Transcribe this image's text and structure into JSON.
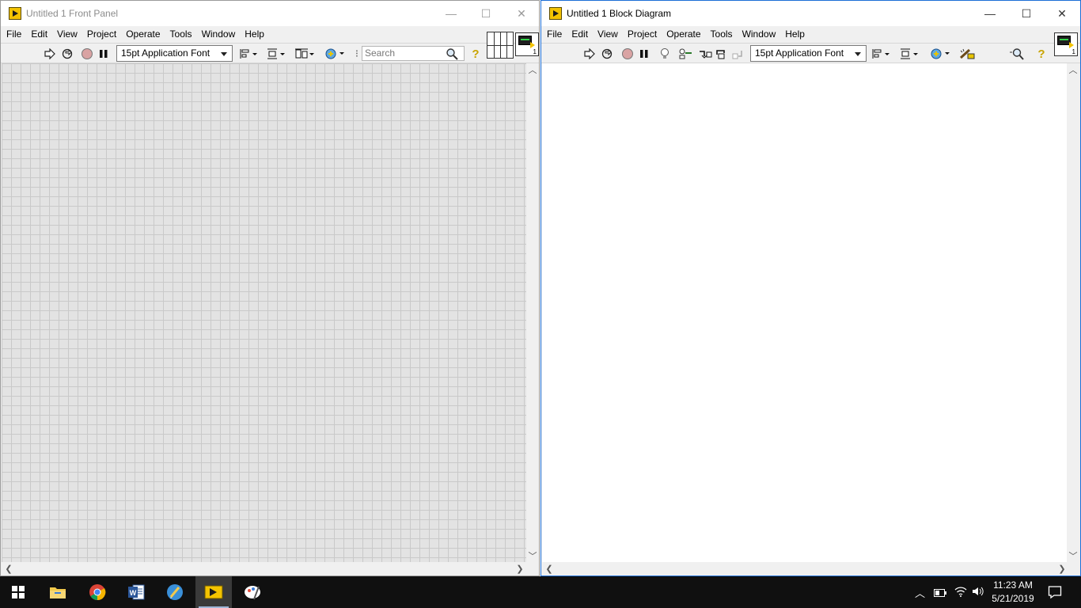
{
  "front_panel": {
    "title": "Untitled 1 Front Panel",
    "caption_buttons": {
      "minimize": "—",
      "maximize": "☐",
      "close": "✕"
    },
    "menu": [
      "File",
      "Edit",
      "View",
      "Project",
      "Operate",
      "Tools",
      "Window",
      "Help"
    ],
    "toolbar": {
      "font": "15pt Application Font",
      "search_placeholder": "Search",
      "help_glyph": "?"
    },
    "vi_icon_number": "1",
    "grid_visible": true
  },
  "block_diagram": {
    "title": "Untitled 1 Block Diagram",
    "caption_buttons": {
      "minimize": "—",
      "maximize": "☐",
      "close": "✕"
    },
    "menu": [
      "File",
      "Edit",
      "View",
      "Project",
      "Operate",
      "Tools",
      "Window",
      "Help"
    ],
    "toolbar": {
      "font": "15pt Application Font",
      "help_glyph": "?"
    },
    "vi_icon_number": "1"
  },
  "taskbar": {
    "time": "11:23 AM",
    "date": "5/21/2019",
    "apps": [
      "windows-start",
      "file-explorer",
      "chrome",
      "word",
      "labview-icon-editor",
      "labview",
      "paint-3d"
    ],
    "active_app": "labview"
  },
  "colors": {
    "labview_yellow": "#f3c300",
    "window_accent": "#1c6ed6",
    "grid_line": "#c9c9c9"
  }
}
